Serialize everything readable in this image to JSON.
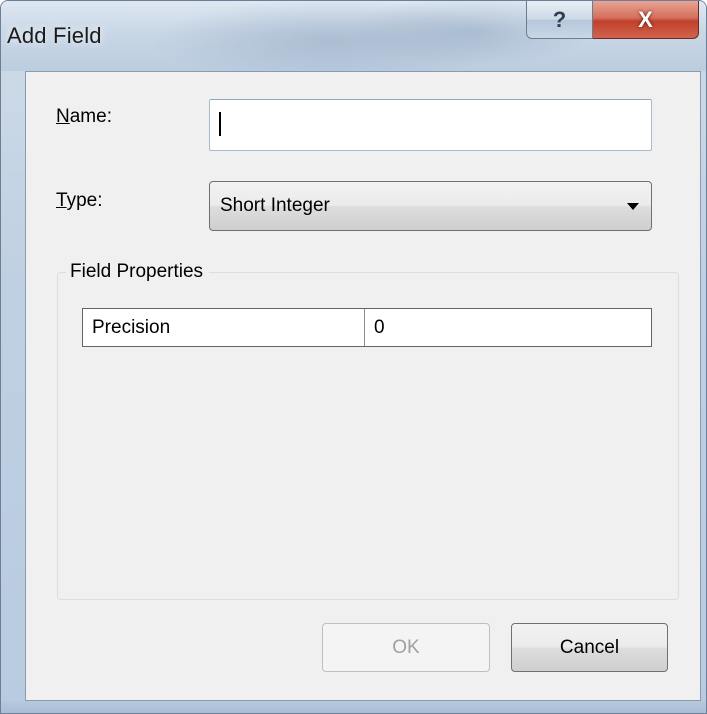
{
  "window": {
    "title": "Add Field",
    "help_glyph": "?",
    "close_glyph": "X"
  },
  "form": {
    "name_label_mnemonic": "N",
    "name_label_rest": "ame:",
    "name_value": "",
    "type_label_mnemonic": "T",
    "type_label_rest": "ype:",
    "type_value": "Short Integer"
  },
  "field_properties": {
    "title": "Field Properties",
    "rows": [
      {
        "name": "Precision",
        "value": "0"
      }
    ]
  },
  "buttons": {
    "ok_label": "OK",
    "cancel_label": "Cancel"
  }
}
